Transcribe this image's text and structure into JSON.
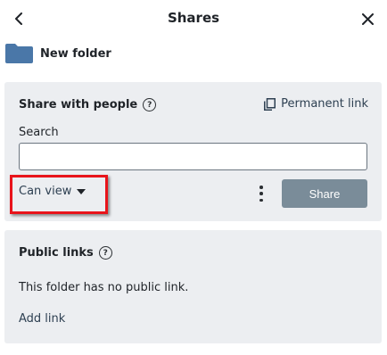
{
  "header": {
    "title": "Shares",
    "back_icon": "chevron-left-icon",
    "close_icon": "close-icon"
  },
  "item": {
    "name": "New folder",
    "icon": "folder-icon",
    "icon_color": "#4a77a8"
  },
  "share_section": {
    "heading": "Share with people",
    "help_icon": "help-icon",
    "permanent_link_label": "Permanent link",
    "search_label": "Search",
    "search_value": "",
    "permission_selected": "Can view",
    "more_icon": "more-vertical-icon",
    "share_button_label": "Share",
    "share_button_color": "#7a8c99"
  },
  "public_links": {
    "heading": "Public links",
    "help_icon": "help-icon",
    "empty_text": "This folder has no public link.",
    "add_link_label": "Add link"
  },
  "annotation": {
    "highlight_color": "#e8141b"
  }
}
